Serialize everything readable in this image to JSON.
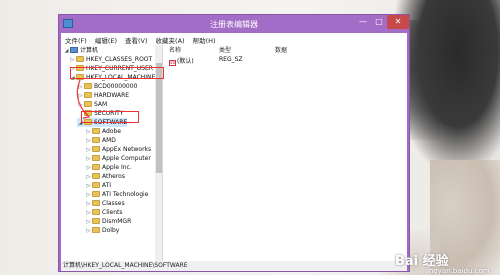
{
  "window": {
    "title": "注册表编辑器",
    "controls": {
      "minimize": "—",
      "maximize": "□",
      "close": "✕"
    }
  },
  "menu": [
    "文件(F)",
    "编辑(E)",
    "查看(V)",
    "收藏夹(A)",
    "帮助(H)"
  ],
  "tree": [
    {
      "label": "计算机",
      "arrow": "◢",
      "icon": "computer-icon"
    },
    {
      "label": "HKEY_CLASSES_ROOT",
      "arrow": "▷",
      "icon": "folder-icon"
    },
    {
      "label": "HKEY_CURRENT_USER",
      "arrow": "▷",
      "icon": "folder-icon"
    },
    {
      "label": "HKEY_LOCAL_MACHINE",
      "arrow": "◢",
      "icon": "folder-icon"
    },
    {
      "label": "BCD00000000",
      "arrow": "▷",
      "icon": "folder-icon"
    },
    {
      "label": "HARDWARE",
      "arrow": "▷",
      "icon": "folder-icon"
    },
    {
      "label": "SAM",
      "arrow": "▷",
      "icon": "folder-icon"
    },
    {
      "label": "SECURITY",
      "arrow": "",
      "icon": "folder-icon"
    },
    {
      "label": "SOFTWARE",
      "arrow": "◢",
      "icon": "folder-icon"
    },
    {
      "label": "Adobe",
      "arrow": "▷",
      "icon": "folder-icon"
    },
    {
      "label": "AMD",
      "arrow": "▷",
      "icon": "folder-icon"
    },
    {
      "label": "AppEx Networks",
      "arrow": "▷",
      "icon": "folder-icon"
    },
    {
      "label": "Apple Computer",
      "arrow": "▷",
      "icon": "folder-icon"
    },
    {
      "label": "Apple Inc.",
      "arrow": "▷",
      "icon": "folder-icon"
    },
    {
      "label": "Atheros",
      "arrow": "▷",
      "icon": "folder-icon"
    },
    {
      "label": "ATI",
      "arrow": "▷",
      "icon": "folder-icon"
    },
    {
      "label": "ATI Technologie",
      "arrow": "▷",
      "icon": "folder-icon"
    },
    {
      "label": "Classes",
      "arrow": "▷",
      "icon": "folder-icon"
    },
    {
      "label": "Clients",
      "arrow": "▷",
      "icon": "folder-icon"
    },
    {
      "label": "DismMGR",
      "arrow": "▷",
      "icon": "folder-icon"
    },
    {
      "label": "Dolby",
      "arrow": "▷",
      "icon": "folder-icon"
    }
  ],
  "list": {
    "columns": [
      "名称",
      "类型",
      "数据"
    ],
    "rows": [
      {
        "name": "(默认)",
        "type": "REG_SZ",
        "data": ""
      }
    ]
  },
  "status": "计算机\\HKEY_LOCAL_MACHINE\\SOFTWARE",
  "watermark": {
    "main": "Bai 经验",
    "sub": "jingyan.baidu.com"
  },
  "colors": {
    "window_frame": "#a36cc6",
    "highlight": "#e33333",
    "close": "#c74a4a"
  }
}
